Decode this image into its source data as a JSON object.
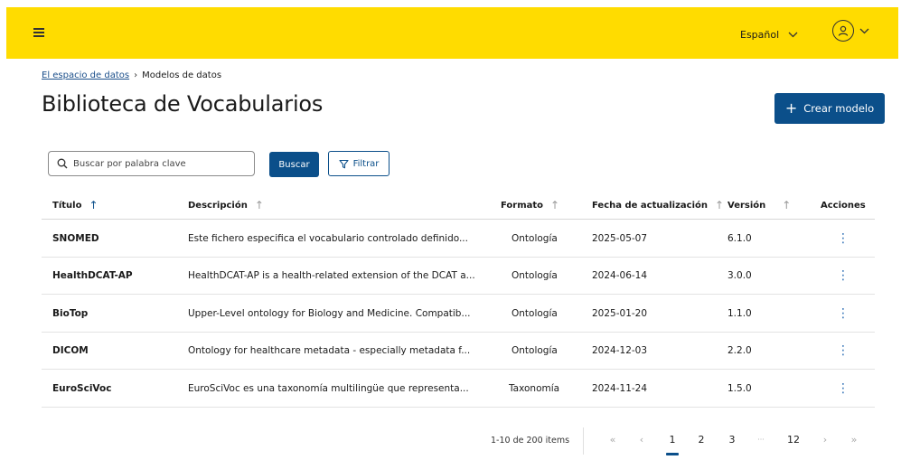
{
  "header": {
    "language": "Español",
    "colors": {
      "bar": "#ffdc00",
      "primary": "#0b4f8a"
    }
  },
  "breadcrumb": {
    "root": "El espacio de datos",
    "current": "Modelos de datos"
  },
  "page": {
    "title": "Biblioteca de Vocabularios",
    "create_button": "Crear modelo"
  },
  "search": {
    "placeholder": "Buscar por palabra clave",
    "value": "",
    "search_button": "Buscar",
    "filter_button": "Filtrar"
  },
  "table": {
    "columns": {
      "title": "Título",
      "description": "Descripción",
      "format": "Formato",
      "updated": "Fecha de actualización",
      "version": "Versión",
      "actions": "Acciones"
    },
    "rows": [
      {
        "title": "SNOMED",
        "description": "Este fichero especifica el vocabulario controlado definido...",
        "format": "Ontología",
        "updated": "2025-05-07",
        "version": "6.1.0"
      },
      {
        "title": "HealthDCAT-AP",
        "description": "HealthDCAT-AP is a health-related extension of the DCAT a...",
        "format": "Ontología",
        "updated": "2024-06-14",
        "version": "3.0.0"
      },
      {
        "title": "BioTop",
        "description": "Upper-Level ontology for Biology and Medicine. Compatib...",
        "format": "Ontología",
        "updated": "2025-01-20",
        "version": "1.1.0"
      },
      {
        "title": "DICOM",
        "description": "Ontology for healthcare metadata - especially metadata f...",
        "format": "Ontología",
        "updated": "2024-12-03",
        "version": "2.2.0"
      },
      {
        "title": "EuroSciVoc",
        "description": "EuroSciVoc es una taxonomía multilingüe que representa...",
        "format": "Taxonomía",
        "updated": "2024-11-24",
        "version": "1.5.0"
      }
    ]
  },
  "pagination": {
    "info": "1-10 de 200 items",
    "pages": [
      "1",
      "2",
      "3",
      "···",
      "12"
    ],
    "current_page": "1"
  }
}
